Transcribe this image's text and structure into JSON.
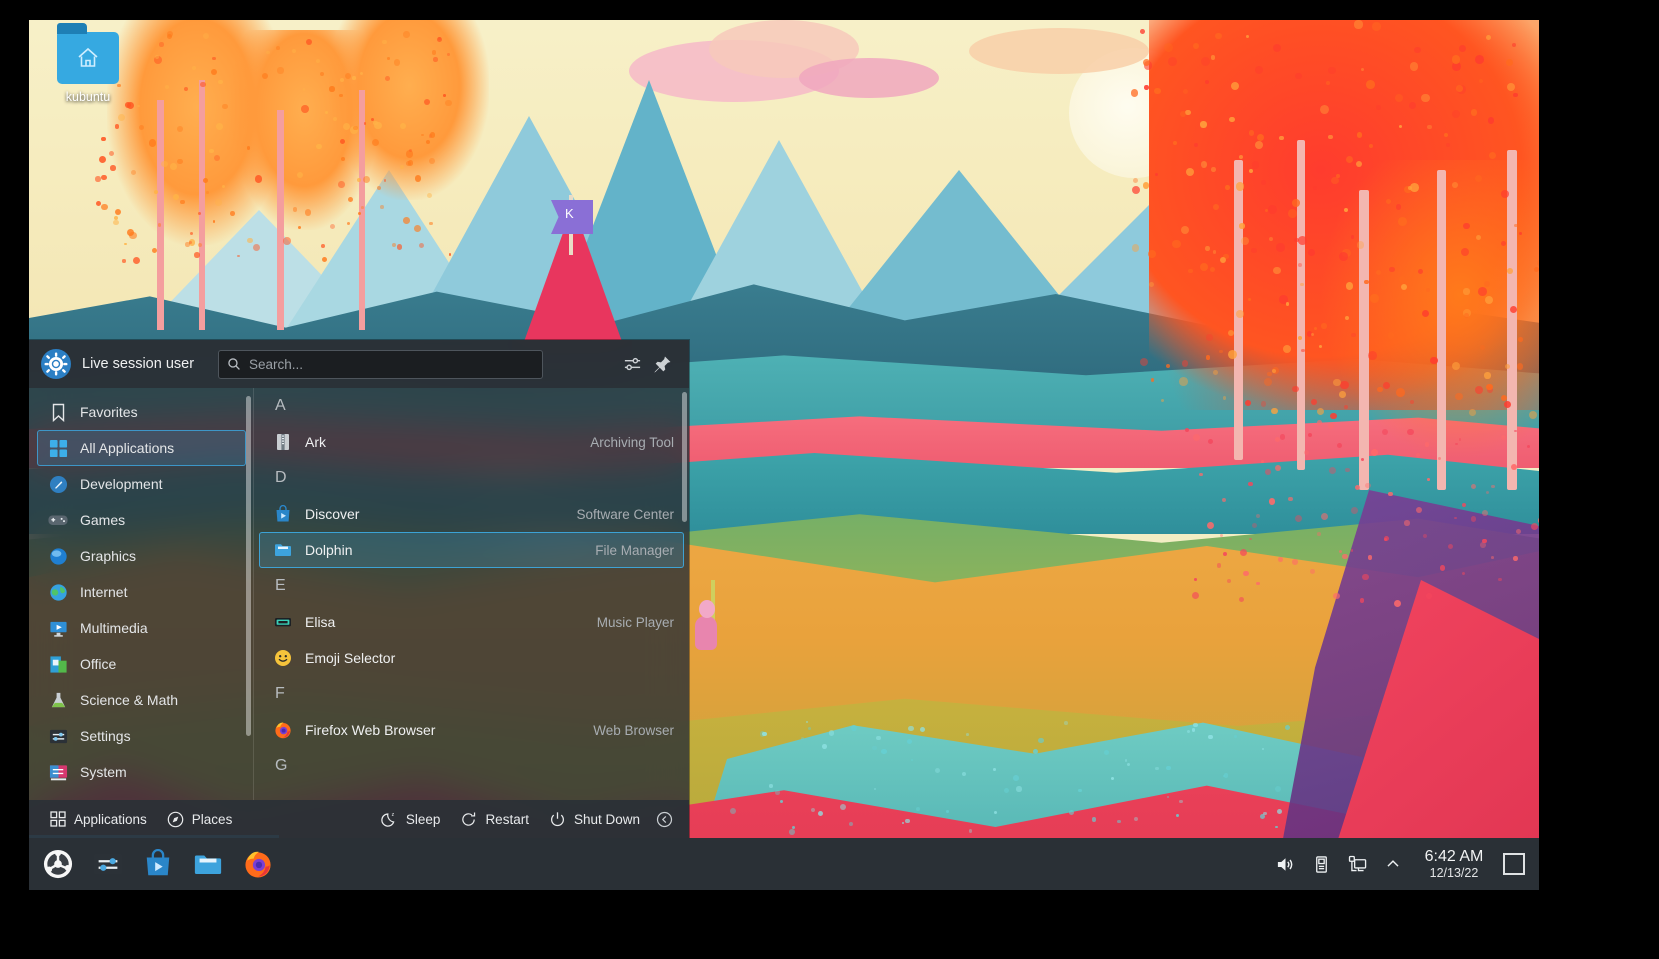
{
  "desktop": {
    "icon": {
      "label": "kubuntu",
      "name": "home-folder-icon"
    }
  },
  "kickoff": {
    "header": {
      "user_name": "Live session user",
      "avatar_icon": "kde-user-avatar",
      "search_placeholder": "Search...",
      "search_value": "",
      "search_icon": "search-icon",
      "configure_icon": "configure-sliders-icon",
      "pin_icon": "pin-icon"
    },
    "sidebar": {
      "items": [
        {
          "label": "Favorites",
          "icon": "bookmark-icon",
          "selected": false
        },
        {
          "label": "All Applications",
          "icon": "grid-apps-icon",
          "selected": true
        },
        {
          "label": "Development",
          "icon": "development-icon",
          "selected": false
        },
        {
          "label": "Games",
          "icon": "gamepad-icon",
          "selected": false
        },
        {
          "label": "Graphics",
          "icon": "graphics-icon",
          "selected": false
        },
        {
          "label": "Internet",
          "icon": "globe-icon",
          "selected": false
        },
        {
          "label": "Multimedia",
          "icon": "multimedia-icon",
          "selected": false
        },
        {
          "label": "Office",
          "icon": "office-icon",
          "selected": false
        },
        {
          "label": "Science & Math",
          "icon": "science-icon",
          "selected": false
        },
        {
          "label": "Settings",
          "icon": "settings-icon",
          "selected": false
        },
        {
          "label": "System",
          "icon": "system-icon",
          "selected": false
        }
      ]
    },
    "applist": [
      {
        "type": "letter",
        "label": "A"
      },
      {
        "type": "app",
        "name": "Ark",
        "desc": "Archiving Tool",
        "icon": "ark-icon",
        "selected": false
      },
      {
        "type": "letter",
        "label": "D"
      },
      {
        "type": "app",
        "name": "Discover",
        "desc": "Software Center",
        "icon": "discover-icon",
        "selected": false
      },
      {
        "type": "app",
        "name": "Dolphin",
        "desc": "File Manager",
        "icon": "dolphin-icon",
        "selected": true
      },
      {
        "type": "letter",
        "label": "E"
      },
      {
        "type": "app",
        "name": "Elisa",
        "desc": "Music Player",
        "icon": "elisa-icon",
        "selected": false
      },
      {
        "type": "app",
        "name": "Emoji Selector",
        "desc": "",
        "icon": "emoji-icon",
        "selected": false
      },
      {
        "type": "letter",
        "label": "F"
      },
      {
        "type": "app",
        "name": "Firefox Web Browser",
        "desc": "Web Browser",
        "icon": "firefox-icon",
        "selected": false
      },
      {
        "type": "letter",
        "label": "G"
      }
    ],
    "footer": {
      "buttons": [
        {
          "label": "Applications",
          "icon": "grid-apps-icon"
        },
        {
          "label": "Places",
          "icon": "compass-icon"
        }
      ],
      "power": [
        {
          "label": "Sleep",
          "icon": "moon-sleep-icon"
        },
        {
          "label": "Restart",
          "icon": "restart-icon"
        },
        {
          "label": "Shut Down",
          "icon": "power-icon"
        }
      ],
      "collapse_icon": "chevron-left-circle-icon"
    }
  },
  "panel": {
    "launchers": [
      {
        "name": "kubuntu-menu-launcher",
        "icon": "kubuntu-logo-icon"
      },
      {
        "name": "system-settings-launcher",
        "icon": "system-settings-icon"
      },
      {
        "name": "discover-launcher",
        "icon": "discover-icon"
      },
      {
        "name": "dolphin-launcher",
        "icon": "dolphin-icon"
      },
      {
        "name": "firefox-launcher",
        "icon": "firefox-icon"
      }
    ],
    "tray": [
      {
        "name": "volume-tray-icon",
        "icon": "speaker-icon"
      },
      {
        "name": "usb-tray-icon",
        "icon": "usb-drive-icon"
      },
      {
        "name": "network-tray-icon",
        "icon": "network-display-icon"
      },
      {
        "name": "tray-expand-arrow",
        "icon": "chevron-up-icon"
      }
    ],
    "clock": {
      "time": "6:42 AM",
      "date": "12/13/22"
    },
    "show_desktop": {
      "name": "show-desktop-button",
      "icon": "rectangle-icon"
    }
  },
  "colors": {
    "accent": "#3daee9",
    "panel_bg": "#2c3238",
    "menu_bg": "#282e34",
    "text": "#eff0f1",
    "text_dim": "#a8adb2"
  }
}
